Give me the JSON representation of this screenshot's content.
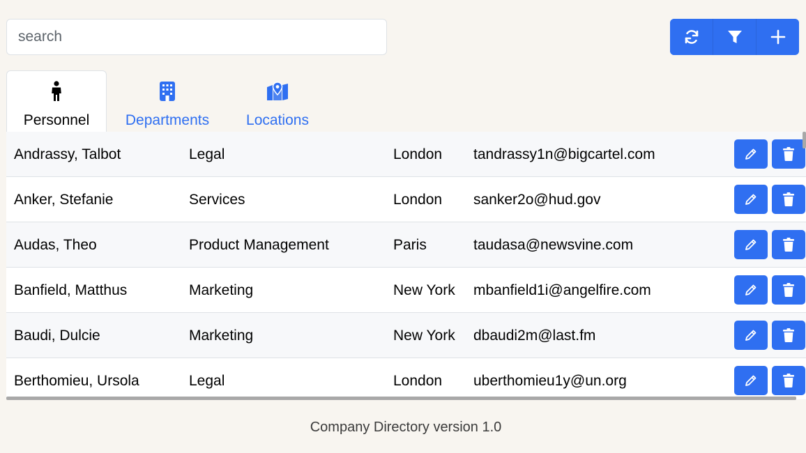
{
  "search": {
    "placeholder": "search",
    "value": ""
  },
  "toolbar": {
    "refresh_icon": "refresh-icon",
    "filter_icon": "filter-icon",
    "add_icon": "plus-icon"
  },
  "tabs": [
    {
      "label": "Personnel",
      "icon": "person-icon",
      "active": true
    },
    {
      "label": "Departments",
      "icon": "building-icon",
      "active": false
    },
    {
      "label": "Locations",
      "icon": "map-location-icon",
      "active": false
    }
  ],
  "rows": [
    {
      "name": "Andrassy, Talbot",
      "department": "Legal",
      "location": "London",
      "email": "tandrassy1n@bigcartel.com"
    },
    {
      "name": "Anker, Stefanie",
      "department": "Services",
      "location": "London",
      "email": "sanker2o@hud.gov"
    },
    {
      "name": "Audas, Theo",
      "department": "Product Management",
      "location": "Paris",
      "email": "taudasa@newsvine.com"
    },
    {
      "name": "Banfield, Matthus",
      "department": "Marketing",
      "location": "New York",
      "email": "mbanfield1i@angelfire.com"
    },
    {
      "name": "Baudi, Dulcie",
      "department": "Marketing",
      "location": "New York",
      "email": "dbaudi2m@last.fm"
    },
    {
      "name": "Berthomieu, Ursola",
      "department": "Legal",
      "location": "London",
      "email": "uberthomieu1y@un.org"
    }
  ],
  "row_actions": {
    "edit_icon": "pencil-icon",
    "delete_icon": "trash-icon"
  },
  "footer": {
    "text": "Company Directory version 1.0"
  },
  "colors": {
    "accent": "#2f6ff1",
    "background": "#f8f5f0"
  }
}
